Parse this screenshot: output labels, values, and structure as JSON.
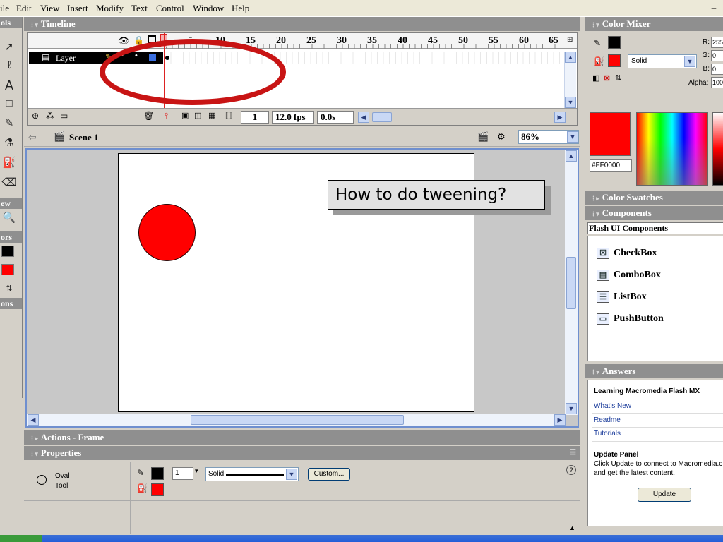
{
  "menubar": {
    "items": [
      "ile",
      "Edit",
      "View",
      "Insert",
      "Modify",
      "Text",
      "Control",
      "Window",
      "Help"
    ],
    "minimize": "–"
  },
  "tools": {
    "header_tools": "ols",
    "header_view": "ew",
    "header_colors": "ors",
    "header_options": "ons"
  },
  "timeline": {
    "title": "Timeline",
    "layer_name": "Layer",
    "ruler_numbers": [
      "1",
      "5",
      "10",
      "15",
      "20",
      "25",
      "30",
      "35",
      "40",
      "45",
      "50",
      "55",
      "60",
      "65"
    ],
    "current_frame": "1",
    "frame_rate": "12.0 fps",
    "elapsed": "0.0s"
  },
  "scene": {
    "name": "Scene 1",
    "zoom": "86%"
  },
  "stage": {
    "text": "How to do tweening?",
    "circle_color": "#ff0000"
  },
  "panels": {
    "actions_title": "Actions - Frame",
    "properties_title": "Properties"
  },
  "properties": {
    "tool_name": "Oval",
    "tool_sub": "Tool",
    "stroke_size": "1",
    "stroke_style": "Solid",
    "custom_button": "Custom...",
    "help": "?"
  },
  "color_mixer": {
    "title": "Color Mixer",
    "fill_type": "Solid",
    "r_label": "R:",
    "g_label": "G:",
    "b_label": "B:",
    "alpha_label": "Alpha:",
    "r": "255",
    "g": "0",
    "b": "0",
    "alpha": "100",
    "hex": "#FF0000"
  },
  "color_swatches": {
    "title": "Color Swatches"
  },
  "components": {
    "title": "Components",
    "set_name": "Flash UI Components",
    "items": [
      "CheckBox",
      "ComboBox",
      "ListBox",
      "PushButton"
    ]
  },
  "answers": {
    "title": "Answers",
    "heading": "Learning Macromedia Flash MX",
    "links": [
      "What's New",
      "Readme",
      "Tutorials"
    ],
    "update_title": "Update Panel",
    "update_text_1": "Click Update to connect to Macromedia.c",
    "update_text_2": "and get the latest content.",
    "update_button": "Update"
  },
  "colors": {
    "accent_red": "#ff0000",
    "annotation": "#c81414",
    "panel_header": "#8f8f8f"
  }
}
